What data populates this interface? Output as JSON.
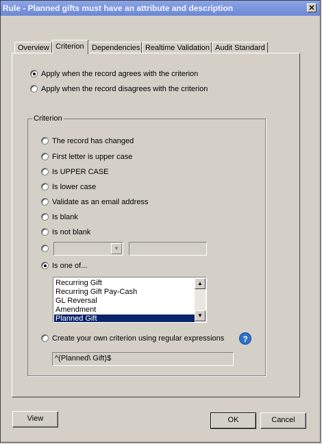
{
  "window": {
    "title": "Rule - Planned gifts must have an attribute and description"
  },
  "tabs": [
    {
      "label": "Overview"
    },
    {
      "label": "Criterion"
    },
    {
      "label": "Dependencies"
    },
    {
      "label": "Realtime Validation"
    },
    {
      "label": "Audit Standard"
    }
  ],
  "apply_options": {
    "agrees": "Apply when the record agrees with the criterion",
    "disagrees": "Apply when the record disagrees with the criterion",
    "selected": "agrees"
  },
  "criterion": {
    "legend": "Criterion",
    "options": [
      "The record has changed",
      "First letter is upper case",
      "Is UPPER CASE",
      "Is lower case",
      "Validate as an email address",
      "Is blank",
      "Is not blank"
    ],
    "is_one_of_label": "Is one of...",
    "list_items": [
      "Recurring Gift",
      "Recurring Gift Pay-Cash",
      "GL Reversal",
      "Amendment",
      "Planned Gift"
    ],
    "list_selected": "Planned Gift",
    "regex_label": "Create your own criterion using regular expressions",
    "regex_value": "^(Planned\\ Gift)$",
    "selected": "is_one_of"
  },
  "buttons": {
    "view": "View",
    "ok": "OK",
    "cancel": "Cancel"
  }
}
